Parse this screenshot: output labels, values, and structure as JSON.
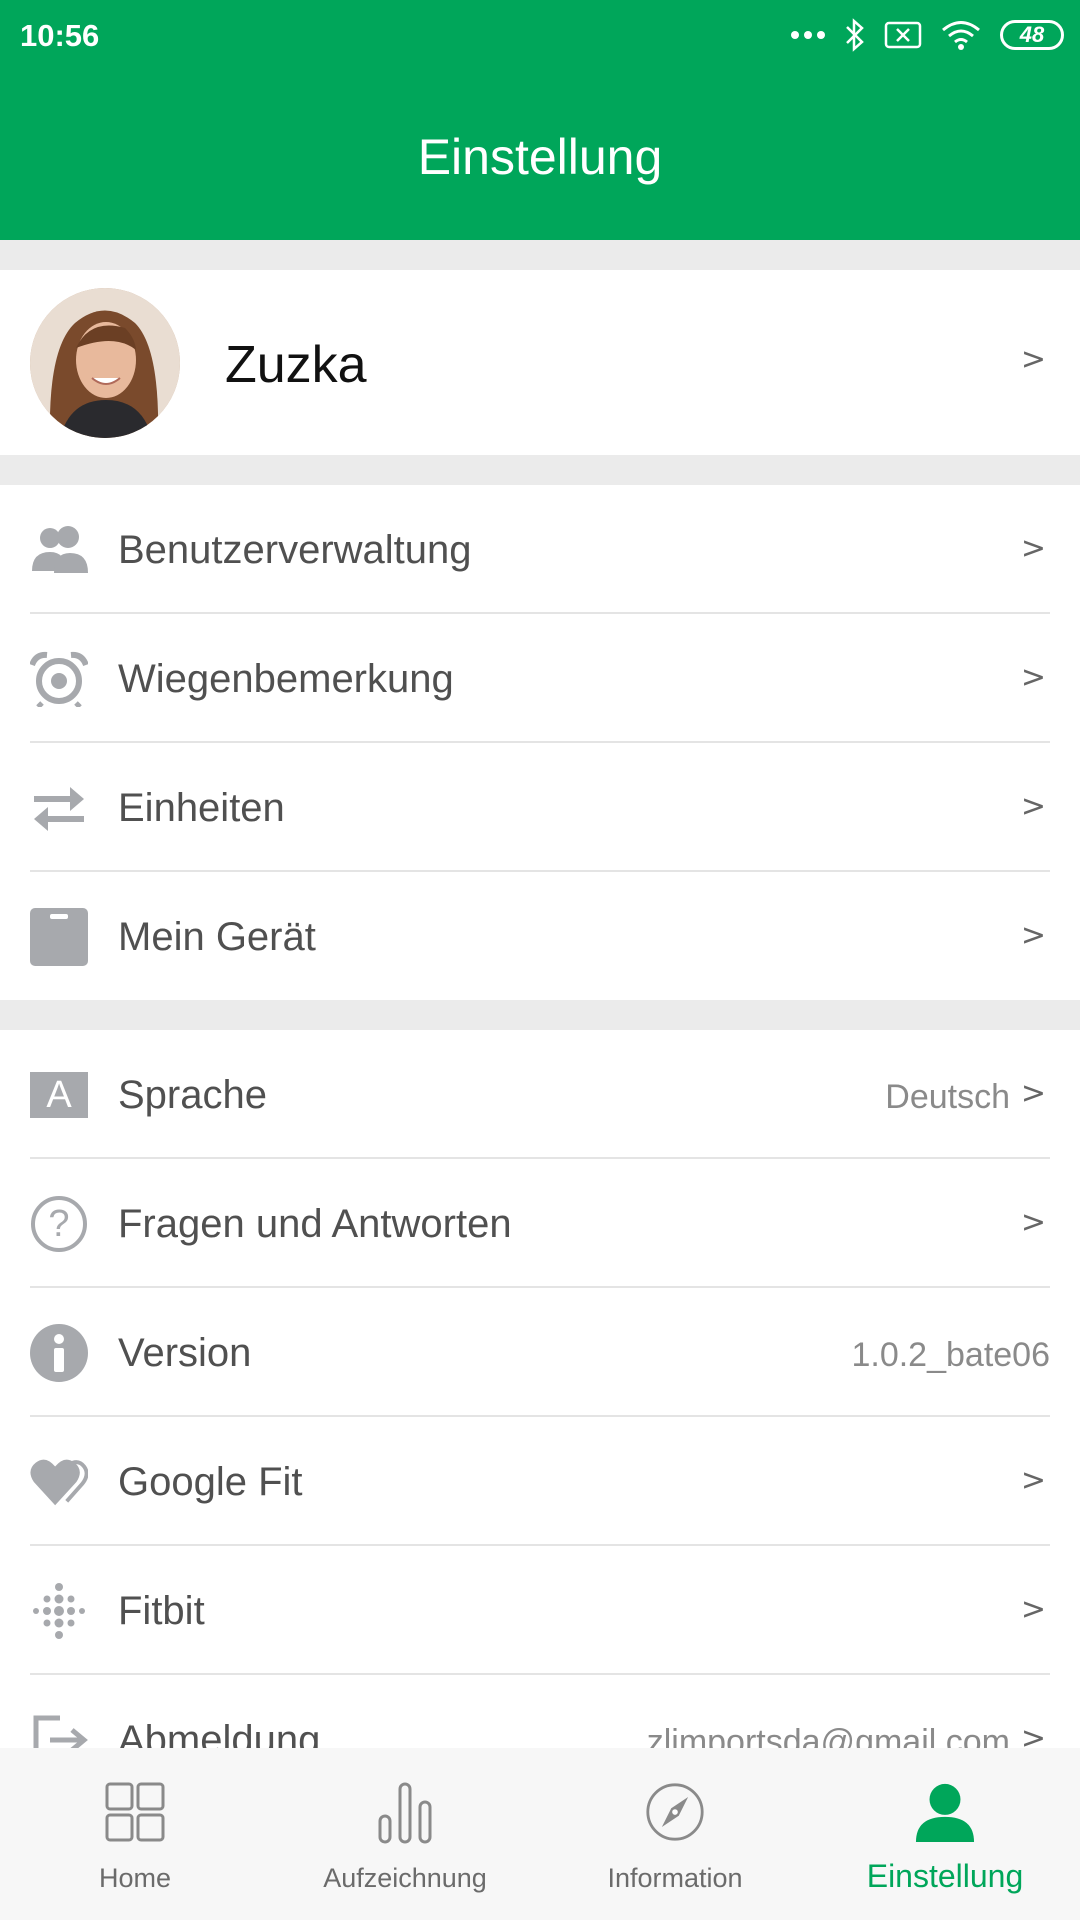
{
  "status_bar": {
    "time": "10:56",
    "battery": "48"
  },
  "header": {
    "title": "Einstellung"
  },
  "profile": {
    "name": "Zuzka",
    "arrow": ">"
  },
  "groups": [
    {
      "items": [
        {
          "label": "Benutzerverwaltung",
          "icon": "users-icon",
          "value": "",
          "arrow": ">"
        },
        {
          "label": "Wiegenbemerkung",
          "icon": "alarm-clock-icon",
          "value": "",
          "arrow": ">"
        },
        {
          "label": "Einheiten",
          "icon": "swap-arrows-icon",
          "value": "",
          "arrow": ">"
        },
        {
          "label": "Mein Gerät",
          "icon": "scale-device-icon",
          "value": "",
          "arrow": ">"
        }
      ]
    },
    {
      "items": [
        {
          "label": "Sprache",
          "icon": "language-icon",
          "icon_text": "A",
          "value": "Deutsch",
          "arrow": ">"
        },
        {
          "label": "Fragen und Antworten",
          "icon": "question-icon",
          "icon_text": "?",
          "value": "",
          "arrow": ">"
        },
        {
          "label": "Version",
          "icon": "info-icon",
          "value": "1.0.2_bate06",
          "arrow": ""
        },
        {
          "label": "Google Fit",
          "icon": "heart-icon",
          "value": "",
          "arrow": ">"
        },
        {
          "label": "Fitbit",
          "icon": "fitbit-icon",
          "value": "",
          "arrow": ">"
        },
        {
          "label": "Abmeldung",
          "icon": "logout-icon",
          "value": "zlimportsda@gmail.com",
          "arrow": ">"
        }
      ]
    }
  ],
  "tabs": [
    {
      "label": "Home",
      "icon": "home-grid-icon",
      "active": false
    },
    {
      "label": "Aufzeichnung",
      "icon": "bar-chart-icon",
      "active": false
    },
    {
      "label": "Information",
      "icon": "compass-icon",
      "active": false
    },
    {
      "label": "Einstellung",
      "icon": "person-icon",
      "active": true
    }
  ],
  "colors": {
    "accent": "#00a65a",
    "background": "#ebebeb",
    "icon_gray": "#a7a9ad"
  }
}
